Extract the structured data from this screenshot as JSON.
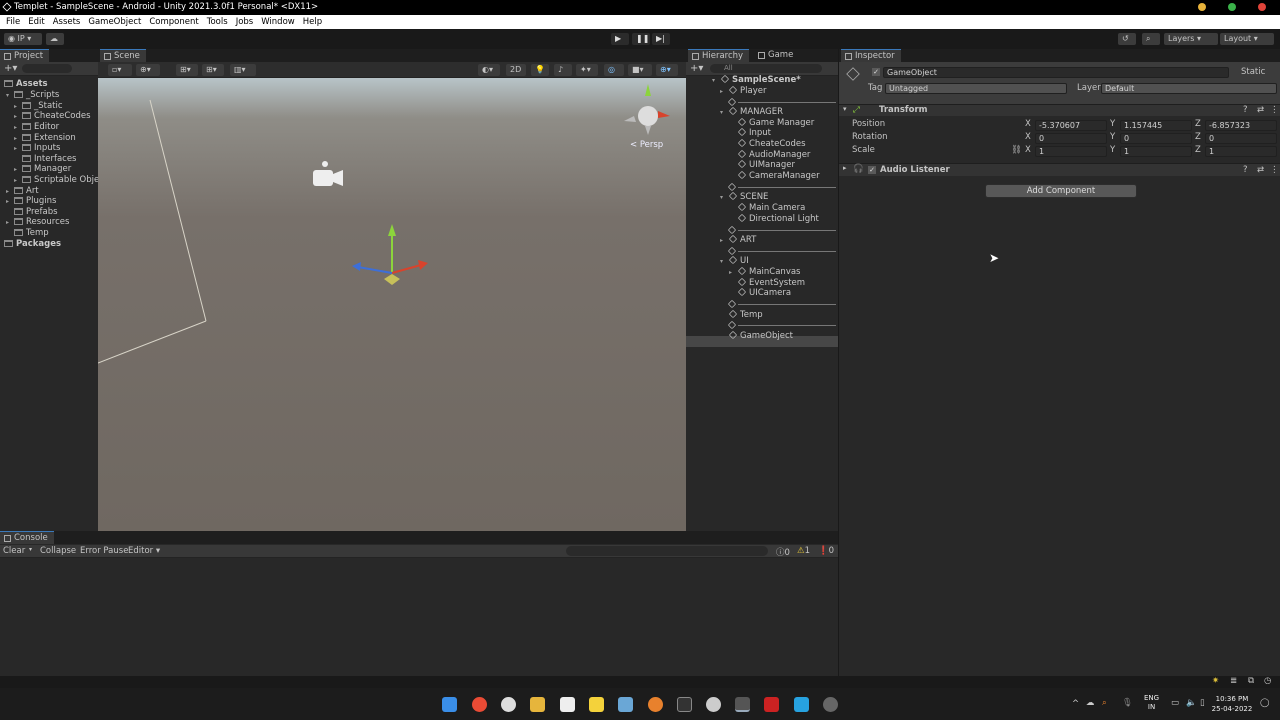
{
  "window": {
    "title": "Templet - SampleScene - Android - Unity 2021.3.0f1 Personal* <DX11>"
  },
  "menu": [
    "File",
    "Edit",
    "Assets",
    "GameObject",
    "Component",
    "Tools",
    "Jobs",
    "Window",
    "Help"
  ],
  "toolbar": {
    "account": "IP",
    "layers": "Layers",
    "layout": "Layout"
  },
  "project": {
    "tab": "Project",
    "tree": [
      "Assets",
      "_Scripts",
      "_Static",
      "CheateCodes",
      "Editor",
      "Extension",
      "Inputs",
      "Interfaces",
      "Manager",
      "Scriptable Obje",
      "Art",
      "Plugins",
      "Prefabs",
      "Resources",
      "Temp",
      "Packages"
    ]
  },
  "scene": {
    "tab": "Scene",
    "two_d": "2D",
    "persp": "< Persp"
  },
  "hierarchy": {
    "tab": "Hierarchy",
    "game_tab": "Game",
    "search": "All",
    "items": [
      "SampleScene*",
      "Player",
      "MANAGER",
      "Game Manager",
      "Input",
      "CheateCodes",
      "AudioManager",
      "UIManager",
      "CameraManager",
      "SCENE",
      "Main Camera",
      "Directional Light",
      "ART",
      "UI",
      "MainCanvas",
      "EventSystem",
      "UICamera",
      "Temp",
      "GameObject"
    ]
  },
  "inspector": {
    "tab": "Inspector",
    "name": "GameObject",
    "static": "Static",
    "tag_label": "Tag",
    "tag": "Untagged",
    "layer_label": "Layer",
    "layer": "Default",
    "transform": "Transform",
    "position_label": "Position",
    "rotation_label": "Rotation",
    "scale_label": "Scale",
    "axes": [
      "X",
      "Y",
      "Z"
    ],
    "position": [
      "-5.370607",
      "1.157445",
      "-6.857323"
    ],
    "rotation": [
      "0",
      "0",
      "0"
    ],
    "scale": [
      "1",
      "1",
      "1"
    ],
    "audio_listener": "Audio Listener",
    "add_component": "Add Component"
  },
  "console": {
    "tab": "Console",
    "clear": "Clear",
    "collapse": "Collapse",
    "error_pause": "Error Pause",
    "editor": "Editor",
    "msg": "0",
    "warn": "1",
    "err": "0"
  },
  "taskbar": {
    "lang1": "ENG",
    "lang2": "IN",
    "time": "10:36 PM",
    "date": "25-04-2022"
  }
}
